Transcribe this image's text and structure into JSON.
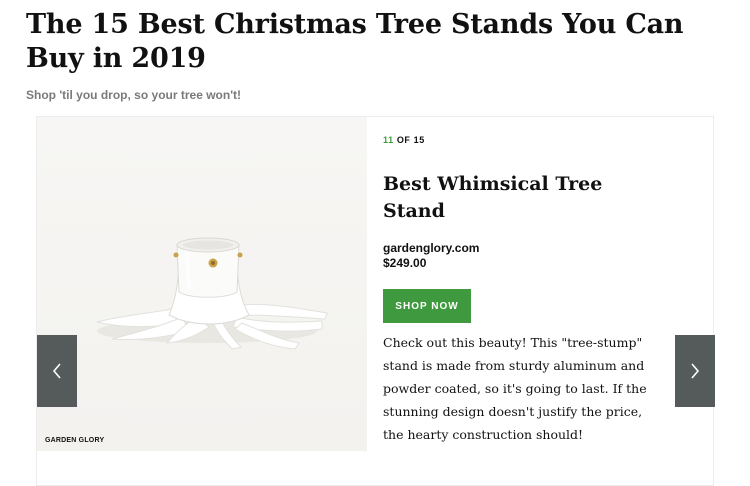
{
  "article": {
    "headline": "The 15 Best Christmas Tree Stands You Can Buy in 2019",
    "subhead": "Shop 'til you drop, so your tree won't!"
  },
  "slide": {
    "index": "11",
    "of_total": "OF 15",
    "title": "Best Whimsical Tree Stand",
    "retailer": "gardenglory.com",
    "price": "$249.00",
    "cta": "SHOP NOW",
    "description": "Check out this beauty! This \"tree-stump\" stand is made from sturdy aluminum and powder coated, so it's going to last. If the stunning design doesn't justify the price, the hearty construction should!",
    "image_credit": "GARDEN GLORY"
  },
  "navigation": {
    "prev_icon": "chevron-left-icon",
    "next_icon": "chevron-right-icon"
  },
  "colors": {
    "accent_green": "#3f9a3f",
    "nav_bg": "#555a5a",
    "subhead_gray": "#7a7a7a"
  }
}
